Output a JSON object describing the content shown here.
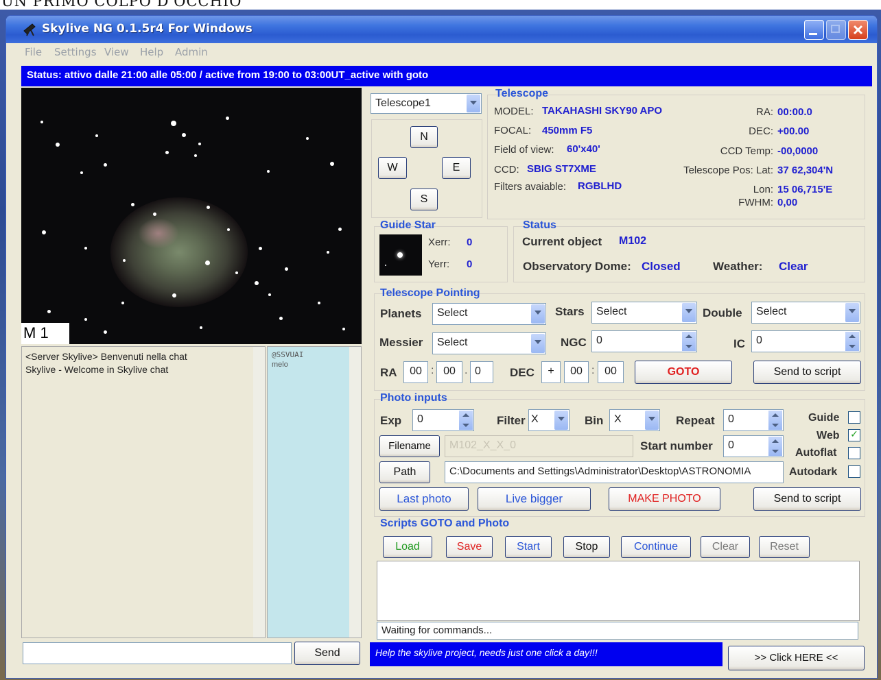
{
  "page_caption": "UN PRIMO COLPO D'OCCHIO",
  "window": {
    "title": "Skylive NG 0.1.5r4 For Windows",
    "controls": [
      "minimize",
      "maximize",
      "close"
    ]
  },
  "menu": [
    "File",
    "Settings",
    "View",
    "Help",
    "Admin"
  ],
  "status_bar": "Status: attivo dalle 21:00 alle 05:00 / active from 19:00 to 03:00UT_active with goto",
  "image": {
    "label": "M 1"
  },
  "chat": {
    "messages": [
      "<Server Skylive> Benvenuti nella chat",
      "Skylive - Welcome in Skylive chat"
    ],
    "users": [
      "@SSVUAI",
      "melo"
    ],
    "send_label": "Send",
    "input_value": ""
  },
  "telescope_select": {
    "value": "Telescope1"
  },
  "direction_pad": {
    "n": "N",
    "w": "W",
    "e": "E",
    "s": "S"
  },
  "telescope": {
    "header": "Telescope",
    "model_label": "MODEL:",
    "model_value": "TAKAHASHI SKY90 APO",
    "focal_label": "FOCAL:",
    "focal_value": "450mm F5",
    "fov_label": "Field of view:",
    "fov_value": "60'x40'",
    "ccd_label": "CCD:",
    "ccd_value": "SBIG ST7XME",
    "filters_label": "Filters avaiable:",
    "filters_value": "RGBLHD",
    "ra_label": "RA:",
    "ra_value": "00:00.0",
    "dec_label": "DEC:",
    "dec_value": "+00.00",
    "ccdtemp_label": "CCD Temp:",
    "ccdtemp_value": "-00,0000",
    "lat_label": "Telescope Pos: Lat:",
    "lat_value": "37 62,304'N",
    "lon_label": "Lon:",
    "lon_value": "15 06,715'E",
    "fwhm_label": "FWHM:",
    "fwhm_value": "0,00"
  },
  "guide_star": {
    "header": "Guide Star",
    "xerr_label": "Xerr:",
    "xerr_value": "0",
    "yerr_label": "Yerr:",
    "yerr_value": "0"
  },
  "status_panel": {
    "header": "Status",
    "current_label": "Current object",
    "current_value": "M102",
    "dome_label": "Observatory Dome:",
    "dome_value": "Closed",
    "weather_label": "Weather:",
    "weather_value": "Clear"
  },
  "pointing": {
    "header": "Telescope Pointing",
    "planets_label": "Planets",
    "planets_value": "Select",
    "stars_label": "Stars",
    "stars_value": "Select",
    "double_label": "Double",
    "double_value": "Select",
    "messier_label": "Messier",
    "messier_value": "Select",
    "ngc_label": "NGC",
    "ngc_value": "0",
    "ic_label": "IC",
    "ic_value": "0",
    "ra_label": "RA",
    "ra_h": "00",
    "ra_sep1": ":",
    "ra_m": "00",
    "ra_sep2": ".",
    "ra_s": "0",
    "dec_label": "DEC",
    "dec_sign": "+",
    "dec_d": "00",
    "dec_sep": ":",
    "dec_m": "00",
    "goto_label": "GOTO",
    "send_script_label": "Send to script"
  },
  "photo": {
    "header": "Photo inputs",
    "exp_label": "Exp",
    "exp_value": "0",
    "filter_label": "Filter",
    "filter_value": "X",
    "bin_label": "Bin",
    "bin_value": "X",
    "repeat_label": "Repeat",
    "repeat_value": "0",
    "guide_label": "Guide",
    "guide_checked": false,
    "web_label": "Web",
    "web_checked": true,
    "autoflat_label": "Autoflat",
    "autoflat_checked": false,
    "autodark_label": "Autodark",
    "autodark_checked": false,
    "filename_btn": "Filename",
    "filename_value": "M102_X_X_0",
    "startnum_label": "Start number",
    "startnum_value": "0",
    "path_btn": "Path",
    "path_value": "C:\\Documents and Settings\\Administrator\\Desktop\\ASTRONOMIA",
    "last_photo": "Last photo",
    "live_bigger": "Live bigger",
    "make_photo": "MAKE PHOTO",
    "send_script_label": "Send to script"
  },
  "scripts": {
    "header": "Scripts GOTO and Photo",
    "buttons": [
      "Load",
      "Save",
      "Start",
      "Stop",
      "Continue",
      "Clear",
      "Reset"
    ],
    "log": "Waiting for commands..."
  },
  "footer": {
    "banner": "Help the skylive project, needs just one click a day!!!",
    "click_here": ">> Click HERE <<"
  },
  "colors": {
    "status_blue": "#0000f0",
    "value_blue": "#2020d0",
    "header_blue": "#2a55d8",
    "goto_red": "#e02020",
    "chat_users_bg": "#c4e6ec"
  }
}
